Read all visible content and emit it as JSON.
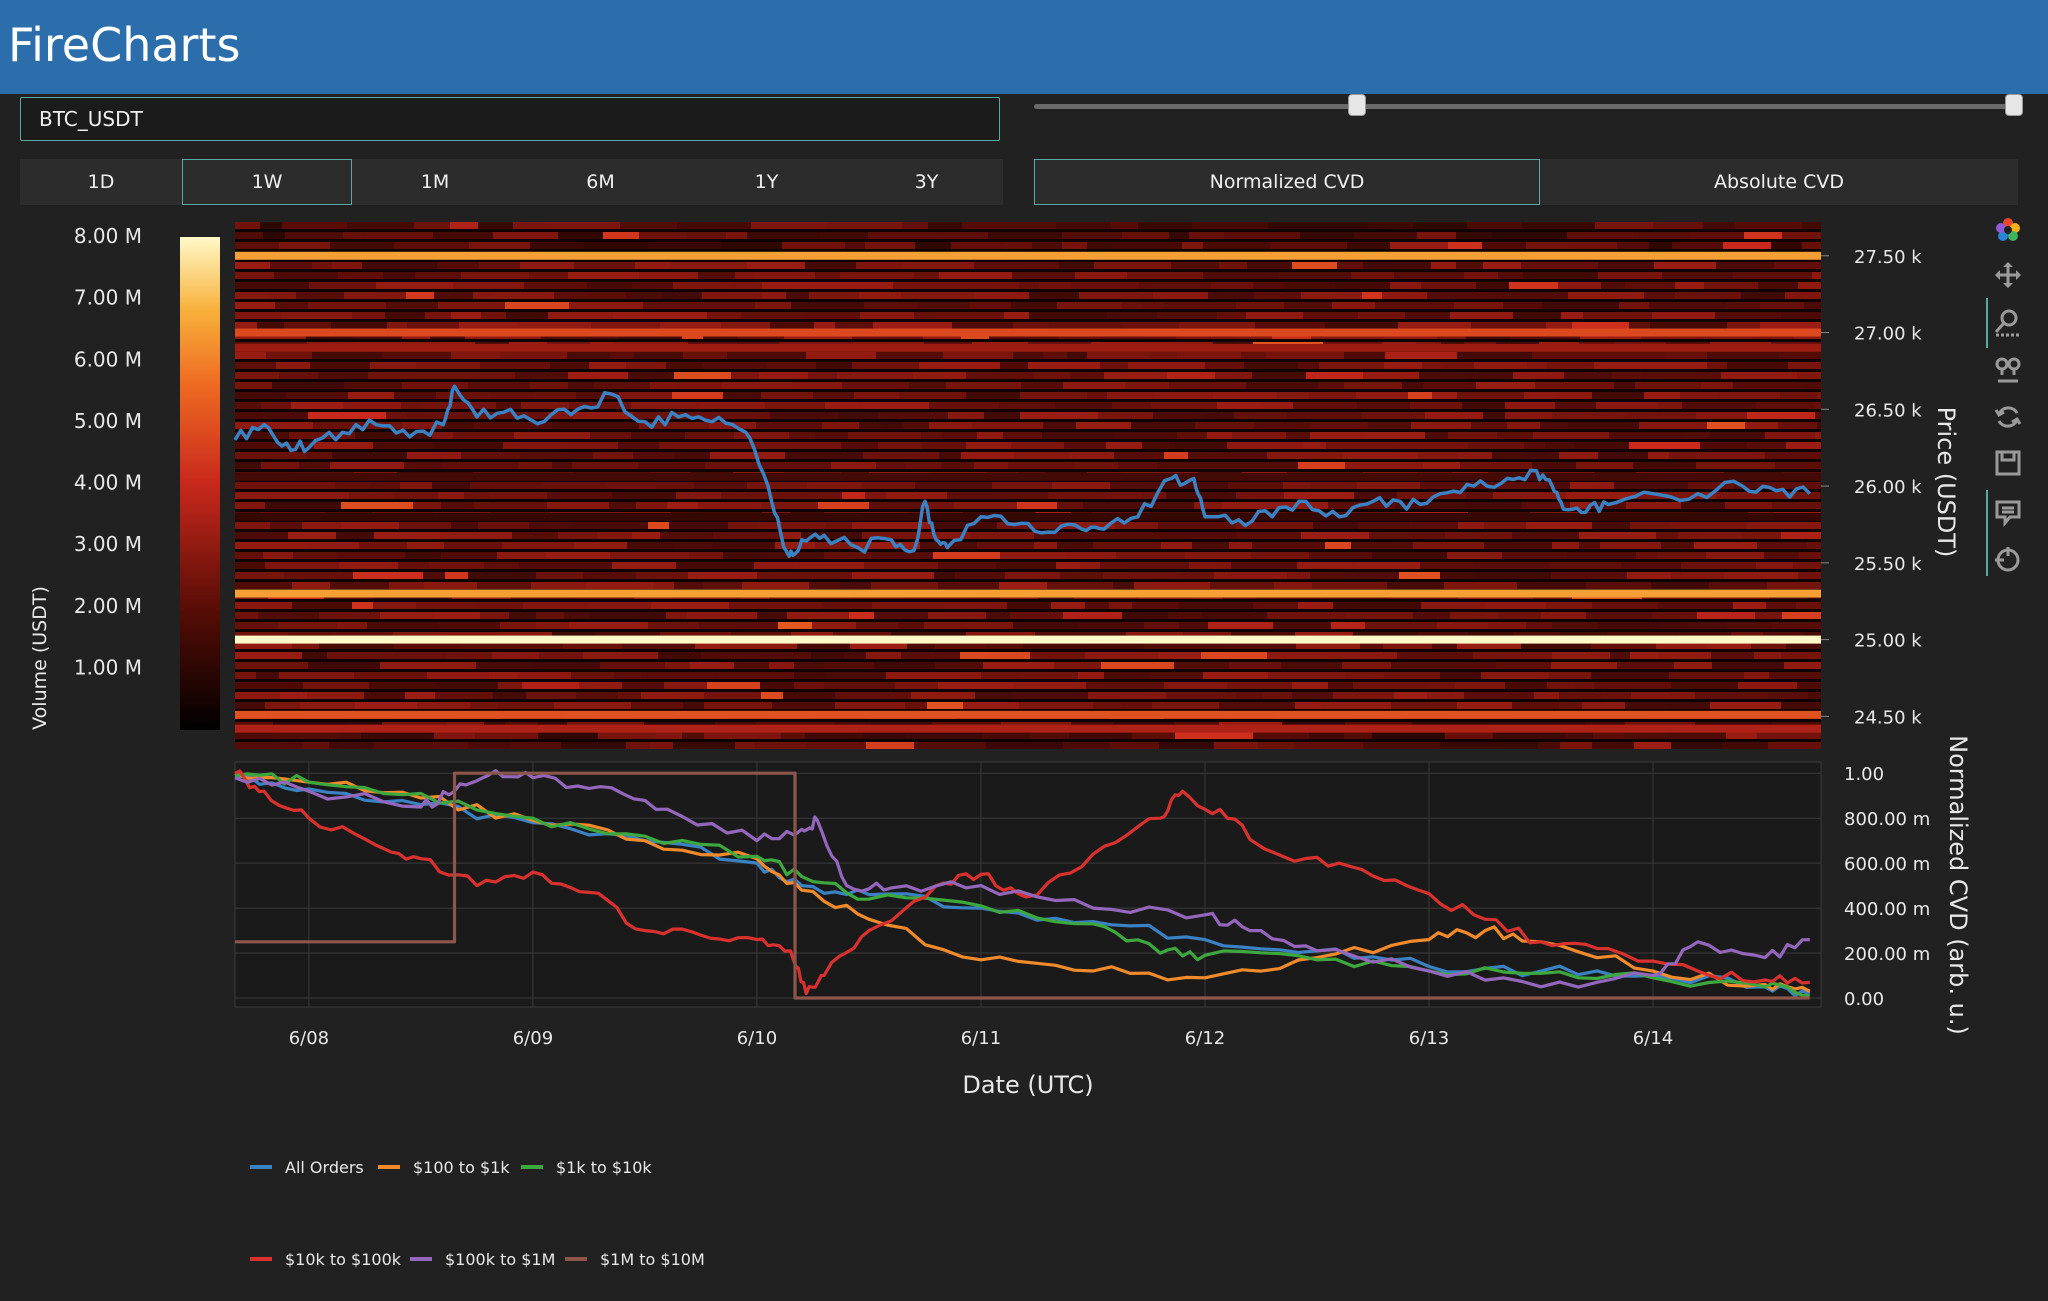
{
  "app": {
    "title": "FireCharts"
  },
  "symbol": {
    "value": "BTC_USDT"
  },
  "range_slider": {
    "low": 0.33,
    "high": 1.0
  },
  "timeframes": [
    "1D",
    "1W",
    "1M",
    "6M",
    "1Y",
    "3Y"
  ],
  "timeframe_active": "1W",
  "cvd_modes": [
    "Normalized CVD",
    "Absolute CVD"
  ],
  "cvd_mode_active": "Normalized CVD",
  "modebar": [
    "plotly-logo-icon",
    "pan-icon",
    "zoom-icon",
    "lasso-icon",
    "reset-axes-icon",
    "download-icon",
    "hover-compare-icon",
    "spike-lines-icon"
  ],
  "colors": {
    "header": "#2c6eab",
    "background": "#212121",
    "plot_bg": "#1a1a1a",
    "accent": "#5aa9a0"
  },
  "chart_data": [
    {
      "type": "heatmap",
      "xlabel": "",
      "ylabel": "Price (USDT)",
      "colorbar_title": "Volume (USDT)",
      "colorbar_ticks": [
        "1.00 M",
        "2.00 M",
        "3.00 M",
        "4.00 M",
        "5.00 M",
        "6.00 M",
        "7.00 M",
        "8.00 M"
      ],
      "colorbar_range": [
        0,
        8000000
      ],
      "y_ticks": [
        "24.50 k",
        "25.00 k",
        "25.50 k",
        "26.00 k",
        "26.50 k",
        "27.00 k",
        "27.50 k"
      ],
      "ylim": [
        24320,
        27720
      ],
      "xlim": [
        -0.33,
        6.75
      ],
      "series": [
        {
          "name": "price",
          "color": "#3a82c4",
          "x": [
            -0.33,
            -0.2,
            -0.1,
            0.0,
            0.15,
            0.3,
            0.45,
            0.6,
            0.65,
            0.75,
            0.9,
            1.05,
            1.2,
            1.35,
            1.5,
            1.65,
            1.8,
            1.95,
            2.05,
            2.12,
            2.16,
            2.2,
            2.3,
            2.45,
            2.6,
            2.7,
            2.75,
            2.8,
            2.85,
            3.0,
            3.15,
            3.3,
            3.45,
            3.55,
            3.7,
            3.85,
            3.95,
            4.0,
            4.15,
            4.3,
            4.45,
            4.6,
            4.75,
            4.9,
            5.05,
            5.2,
            5.35,
            5.48,
            5.55,
            5.6,
            5.7,
            5.8,
            6.0,
            6.2,
            6.4,
            6.55,
            6.7
          ],
          "y": [
            26300,
            26400,
            26280,
            26250,
            26350,
            26400,
            26320,
            26400,
            26650,
            26450,
            26500,
            26420,
            26500,
            26600,
            26420,
            26450,
            26420,
            26350,
            26000,
            25600,
            25550,
            25650,
            25680,
            25600,
            25650,
            25580,
            25900,
            25650,
            25600,
            25800,
            25750,
            25700,
            25720,
            25720,
            25800,
            26050,
            26050,
            25800,
            25780,
            25800,
            25900,
            25800,
            25900,
            25850,
            25950,
            26000,
            26050,
            26100,
            26000,
            25850,
            25830,
            25880,
            25950,
            25950,
            26000,
            25970,
            25950
          ]
        }
      ],
      "price_levels": [
        {
          "y": 27500,
          "v": 6500000
        },
        {
          "y": 27000,
          "v": 4800000
        },
        {
          "y": 26900,
          "v": 3200000
        },
        {
          "y": 26060,
          "v": 1500000
        },
        {
          "y": 25800,
          "v": 1200000
        },
        {
          "y": 25300,
          "v": 6500000
        },
        {
          "y": 25000,
          "v": 8000000
        },
        {
          "y": 24510,
          "v": 5000000
        },
        {
          "y": 24420,
          "v": 3500000
        }
      ]
    },
    {
      "type": "line",
      "xlabel": "Date (UTC)",
      "ylabel": "Normalized CVD (arb. u.)",
      "x_ticks": [
        "6/08",
        "6/09",
        "6/10",
        "6/11",
        "6/12",
        "6/13",
        "6/14"
      ],
      "y_ticks": [
        "0.00",
        "200.00 m",
        "400.00 m",
        "600.00 m",
        "800.00 m",
        "1.00"
      ],
      "ylim": [
        -0.04,
        1.05
      ],
      "xlim": [
        -0.33,
        6.75
      ],
      "series": [
        {
          "name": "All Orders",
          "color": "#3a82c4",
          "x": [
            -0.33,
            0.0,
            0.5,
            1.0,
            1.5,
            2.0,
            2.2,
            2.5,
            3.0,
            3.5,
            4.0,
            4.5,
            5.0,
            5.5,
            6.0,
            6.5,
            6.7
          ],
          "y": [
            0.98,
            0.93,
            0.86,
            0.78,
            0.7,
            0.6,
            0.5,
            0.46,
            0.4,
            0.34,
            0.26,
            0.21,
            0.14,
            0.12,
            0.1,
            0.05,
            0.02
          ]
        },
        {
          "name": "$100 to $1k",
          "color": "#f08a2b",
          "x": [
            -0.33,
            0.0,
            0.5,
            1.0,
            1.5,
            2.0,
            2.2,
            2.5,
            3.0,
            3.5,
            4.0,
            4.5,
            5.0,
            5.25,
            5.5,
            6.0,
            6.5,
            6.7
          ],
          "y": [
            1.0,
            0.96,
            0.89,
            0.79,
            0.7,
            0.62,
            0.48,
            0.35,
            0.17,
            0.12,
            0.09,
            0.18,
            0.26,
            0.3,
            0.25,
            0.12,
            0.06,
            0.03
          ]
        },
        {
          "name": "$1k to $10k",
          "color": "#3da83d",
          "x": [
            -0.33,
            0.0,
            0.5,
            1.0,
            1.5,
            2.0,
            2.2,
            2.5,
            3.0,
            3.5,
            3.8,
            4.0,
            4.5,
            5.0,
            5.5,
            6.0,
            6.5,
            6.7
          ],
          "y": [
            0.99,
            0.96,
            0.91,
            0.8,
            0.72,
            0.63,
            0.54,
            0.44,
            0.41,
            0.33,
            0.2,
            0.19,
            0.17,
            0.12,
            0.11,
            0.09,
            0.05,
            0.01
          ]
        },
        {
          "name": "$10k to $100k",
          "color": "#d9312e",
          "x": [
            -0.33,
            -0.2,
            0.0,
            0.3,
            0.5,
            0.75,
            1.0,
            1.25,
            1.5,
            1.75,
            2.0,
            2.15,
            2.22,
            2.3,
            2.5,
            2.8,
            3.0,
            3.2,
            3.5,
            3.8,
            3.9,
            4.1,
            4.3,
            4.6,
            4.9,
            5.2,
            5.5,
            5.8,
            6.2,
            6.5,
            6.7
          ],
          "y": [
            1.0,
            0.92,
            0.8,
            0.68,
            0.62,
            0.5,
            0.56,
            0.47,
            0.3,
            0.28,
            0.26,
            0.21,
            0.02,
            0.1,
            0.3,
            0.5,
            0.55,
            0.45,
            0.64,
            0.8,
            0.92,
            0.8,
            0.65,
            0.6,
            0.5,
            0.37,
            0.25,
            0.22,
            0.12,
            0.08,
            0.07
          ]
        },
        {
          "name": "$100k to $1M",
          "color": "#9467bd",
          "x": [
            -0.33,
            0.0,
            0.5,
            0.65,
            0.8,
            1.0,
            1.3,
            1.6,
            2.0,
            2.2,
            2.27,
            2.4,
            2.6,
            3.0,
            3.5,
            4.0,
            4.2,
            4.5,
            5.0,
            5.5,
            6.0,
            6.2,
            6.5,
            6.7
          ],
          "y": [
            0.98,
            0.92,
            0.85,
            0.92,
            0.99,
            0.98,
            0.94,
            0.84,
            0.7,
            0.75,
            0.79,
            0.5,
            0.49,
            0.5,
            0.4,
            0.37,
            0.3,
            0.21,
            0.12,
            0.05,
            0.1,
            0.25,
            0.18,
            0.26
          ]
        },
        {
          "name": "$1M to $10M",
          "color": "#8c564b",
          "x": [
            -0.33,
            0.65,
            0.65,
            2.17,
            2.17,
            6.7
          ],
          "y": [
            0.25,
            0.25,
            1.0,
            1.0,
            0.0,
            0.0
          ]
        }
      ]
    }
  ]
}
